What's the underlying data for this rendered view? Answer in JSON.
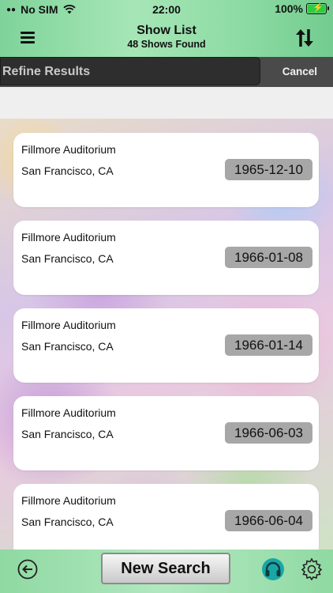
{
  "status_bar": {
    "carrier": "No SIM",
    "time": "22:00",
    "battery": "100%"
  },
  "header": {
    "title": "Show List",
    "subtitle": "48 Shows Found"
  },
  "refine": {
    "placeholder": "Refine Results",
    "cancel_label": "Cancel"
  },
  "shows": [
    {
      "venue": "Fillmore Auditorium",
      "city": "San Francisco, CA",
      "date": "1965-12-10"
    },
    {
      "venue": "Fillmore Auditorium",
      "city": "San Francisco, CA",
      "date": "1966-01-08"
    },
    {
      "venue": "Fillmore Auditorium",
      "city": "San Francisco, CA",
      "date": "1966-01-14"
    },
    {
      "venue": "Fillmore Auditorium",
      "city": "San Francisco, CA",
      "date": "1966-06-03"
    },
    {
      "venue": "Fillmore Auditorium",
      "city": "San Francisco, CA",
      "date": "1966-06-04"
    }
  ],
  "footer": {
    "new_search_label": "New Search"
  },
  "icons": {
    "menu": "hamburger-menu-icon",
    "sort": "sort-arrows-icon",
    "back": "back-arrow-icon",
    "headphones": "headphones-icon",
    "settings": "gear-icon",
    "wifi": "wifi-icon",
    "battery": "battery-charging-icon"
  },
  "colors": {
    "header_green": "#8fdca6",
    "date_badge": "#a7a7a7",
    "refine_bar": "#2e2e2e",
    "headphones_teal": "#1aa6a6"
  }
}
